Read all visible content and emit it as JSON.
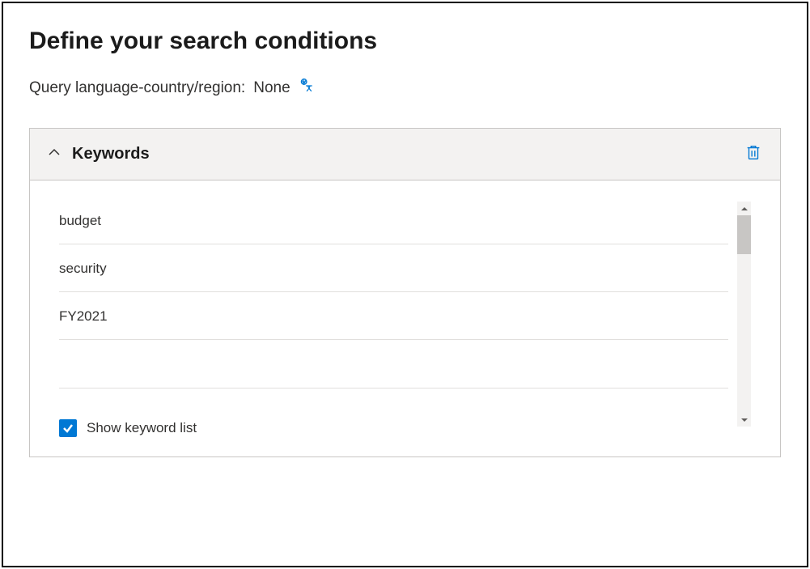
{
  "header": {
    "title": "Define your search conditions",
    "query_lang_label": "Query language-country/region:",
    "query_lang_value": "None"
  },
  "card": {
    "title": "Keywords",
    "keywords": [
      "budget",
      "security",
      "FY2021"
    ],
    "checkbox_label": "Show keyword list",
    "checkbox_checked": true
  }
}
